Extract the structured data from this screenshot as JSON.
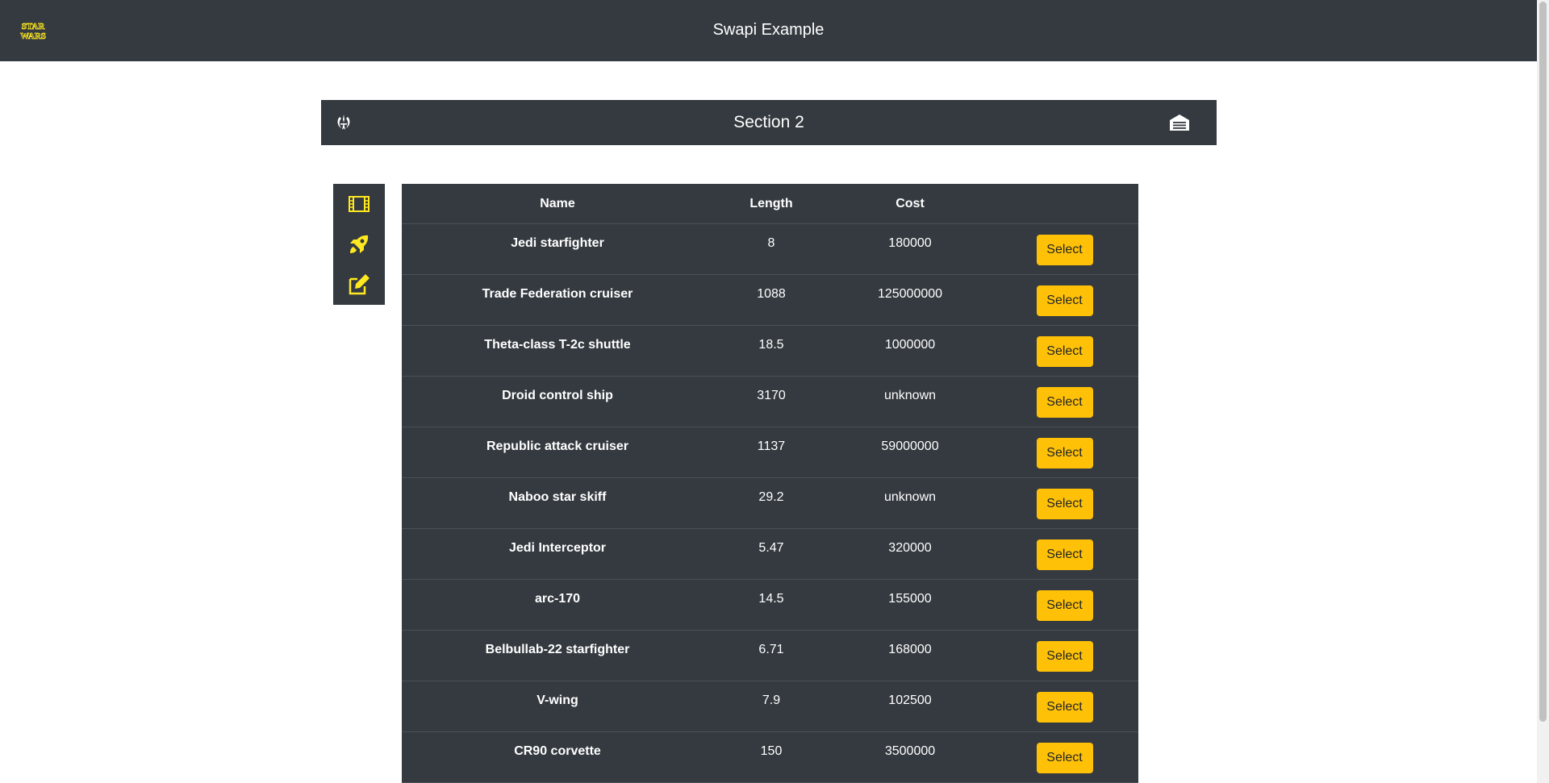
{
  "header": {
    "title": "Swapi Example",
    "logo_text": "STAR WARS",
    "logo_color": "#ffe81f",
    "background": "#343a40"
  },
  "section": {
    "title": "Section 2",
    "left_icon": "jedi-order-icon",
    "right_icon": "hangar-icon"
  },
  "sidebar": {
    "items": [
      {
        "icon": "film-icon",
        "target": "films"
      },
      {
        "icon": "rocket-icon",
        "target": "starships"
      },
      {
        "icon": "edit-icon",
        "target": "edit"
      }
    ],
    "icon_color": "#ffe81f"
  },
  "table": {
    "columns": [
      "Name",
      "Length",
      "Cost",
      ""
    ],
    "rows": [
      {
        "name": "Jedi starfighter",
        "length": "8",
        "cost": "180000",
        "action": "Select"
      },
      {
        "name": "Trade Federation cruiser",
        "length": "1088",
        "cost": "125000000",
        "action": "Select"
      },
      {
        "name": "Theta-class T-2c shuttle",
        "length": "18.5",
        "cost": "1000000",
        "action": "Select"
      },
      {
        "name": "Droid control ship",
        "length": "3170",
        "cost": "unknown",
        "action": "Select"
      },
      {
        "name": "Republic attack cruiser",
        "length": "1137",
        "cost": "59000000",
        "action": "Select"
      },
      {
        "name": "Naboo star skiff",
        "length": "29.2",
        "cost": "unknown",
        "action": "Select"
      },
      {
        "name": "Jedi Interceptor",
        "length": "5.47",
        "cost": "320000",
        "action": "Select"
      },
      {
        "name": "arc-170",
        "length": "14.5",
        "cost": "155000",
        "action": "Select"
      },
      {
        "name": "Belbullab-22 starfighter",
        "length": "6.71",
        "cost": "168000",
        "action": "Select"
      },
      {
        "name": "V-wing",
        "length": "7.9",
        "cost": "102500",
        "action": "Select"
      },
      {
        "name": "CR90 corvette",
        "length": "150",
        "cost": "3500000",
        "action": "Select"
      }
    ],
    "button_color": "#ffc107"
  }
}
